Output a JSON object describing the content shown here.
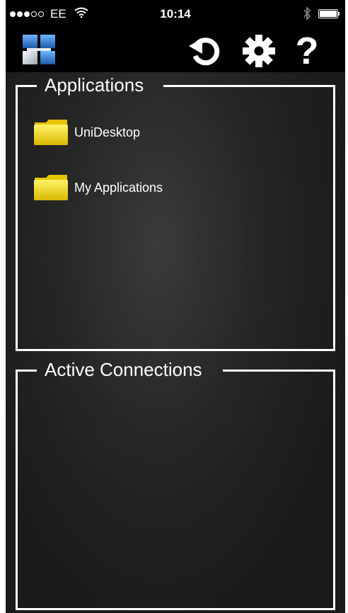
{
  "status_bar": {
    "carrier": "EE",
    "time": "10:14",
    "signal_bars_filled": 3,
    "signal_bars_total": 5,
    "icons": [
      "wifi-icon",
      "bluetooth-icon",
      "battery-icon"
    ]
  },
  "toolbar": {
    "icons": [
      "app-logo-icon",
      "refresh-icon",
      "settings-gear-icon",
      "help-icon"
    ],
    "help_glyph": "?"
  },
  "applications": {
    "title": "Applications",
    "items": [
      {
        "label": "UniDesktop",
        "icon": "folder-icon"
      },
      {
        "label": "My Applications",
        "icon": "folder-icon"
      }
    ]
  },
  "active_connections": {
    "title": "Active Connections",
    "items": []
  },
  "colors": {
    "folder": "#f2d000",
    "background": "#1c1c1c",
    "border": "#ffffff",
    "logo_blue": "#2a6fb8"
  }
}
